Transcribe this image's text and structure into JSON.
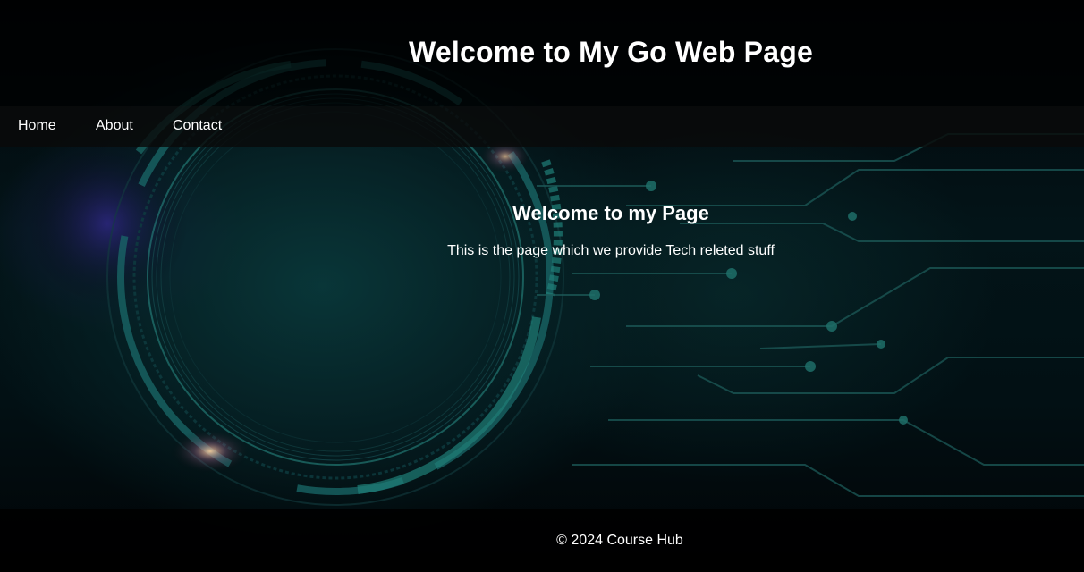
{
  "header": {
    "title": "Welcome to My Go Web Page"
  },
  "nav": {
    "items": [
      {
        "label": "Home"
      },
      {
        "label": "About"
      },
      {
        "label": "Contact"
      }
    ]
  },
  "main": {
    "heading": "Welcome to my Page",
    "text": "This is the page which we provide Tech releted stuff"
  },
  "footer": {
    "text": "© 2024 Course Hub"
  },
  "colors": {
    "text": "#ffffff",
    "background": "#000000",
    "accent_teal": "#1fb3a0"
  }
}
